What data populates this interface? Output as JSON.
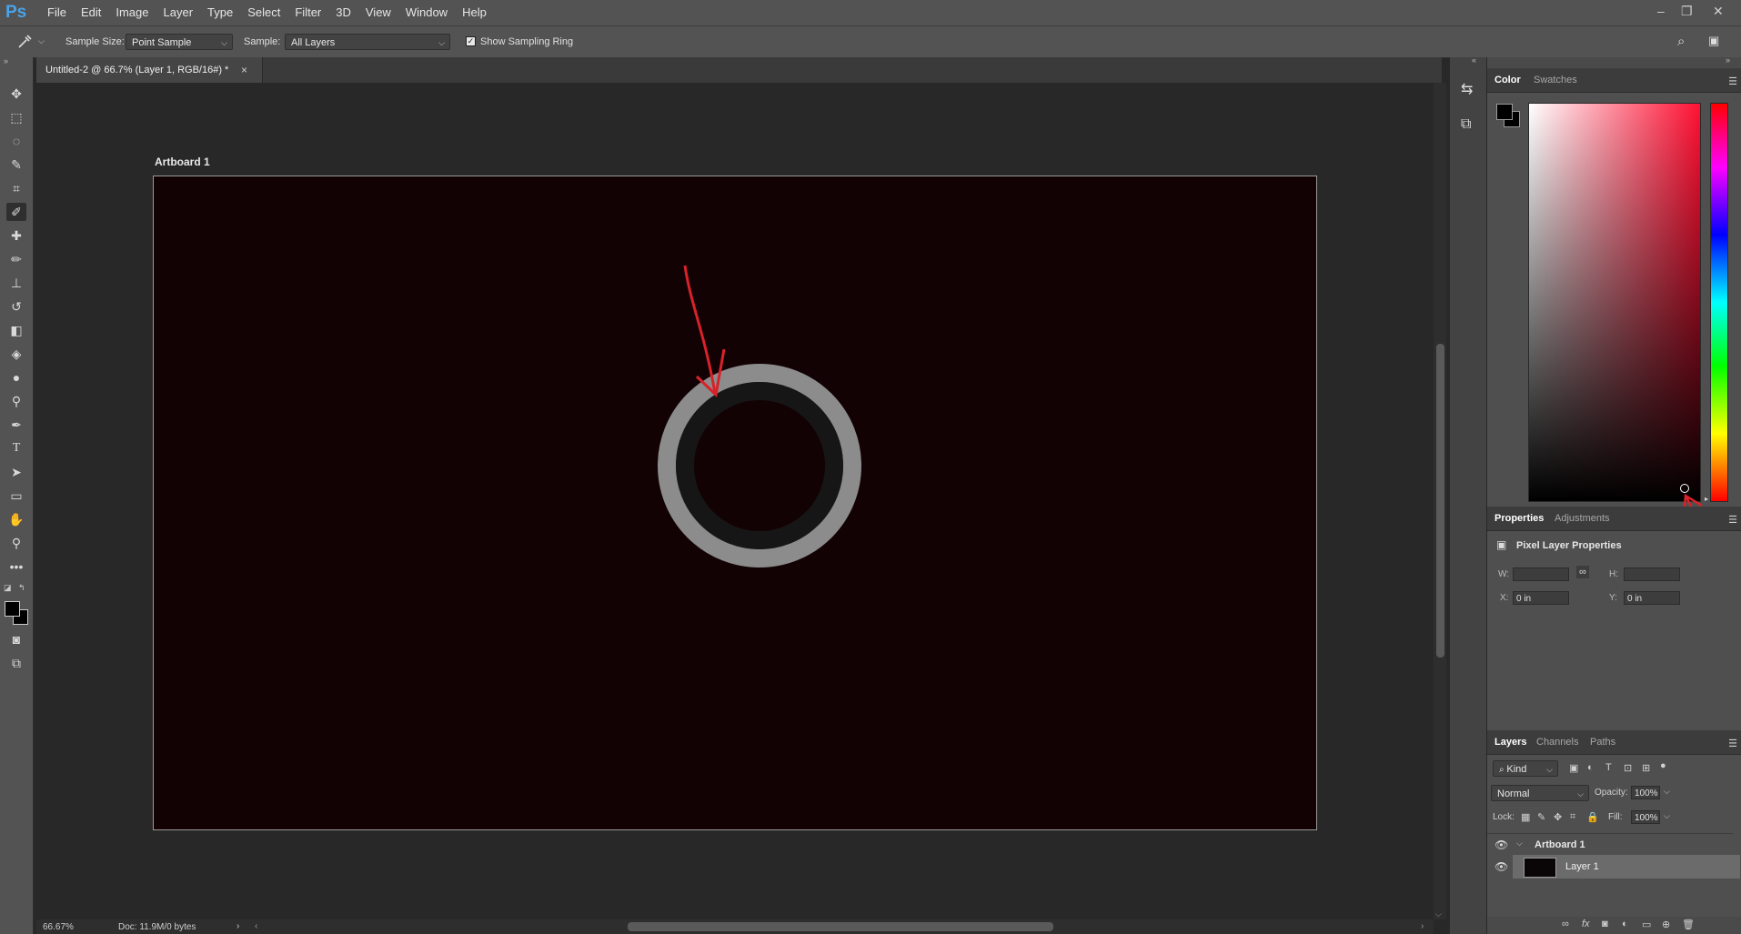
{
  "app": {
    "logo": "Ps"
  },
  "menu": [
    "File",
    "Edit",
    "Image",
    "Layer",
    "Type",
    "Select",
    "Filter",
    "3D",
    "View",
    "Window",
    "Help"
  ],
  "window_controls": {
    "minimize": "–",
    "restore": "❐",
    "close": "✕"
  },
  "options_bar": {
    "sample_size_label": "Sample Size:",
    "sample_size_value": "Point Sample",
    "sample_label": "Sample:",
    "sample_value": "All Layers",
    "show_ring_label": "Show Sampling Ring",
    "show_ring_checked": true
  },
  "document": {
    "tab_title": "Untitled-2 @ 66.7% (Layer 1, RGB/16#) *",
    "artboard_name": "Artboard 1",
    "canvas_color": "#120204",
    "zoom": "66.67%",
    "doc_info": "Doc: 11.9M/0 bytes"
  },
  "tools": [
    "move-icon",
    "marquee-icon",
    "lasso-icon",
    "quick-select-icon",
    "crop-icon",
    "eyedropper-icon",
    "healing-icon",
    "brush-icon",
    "stamp-icon",
    "history-brush-icon",
    "eraser-icon",
    "paint-bucket-icon",
    "blur-icon",
    "dodge-icon",
    "pen-icon",
    "type-icon",
    "path-select-icon",
    "rectangle-icon",
    "hand-icon",
    "zoom-icon",
    "more-icon"
  ],
  "color_panel": {
    "tabs": [
      "Color",
      "Swatches"
    ],
    "active_tab": "Color",
    "foreground": "#000000",
    "background": "#000000",
    "hue": "#ff1133"
  },
  "properties_panel": {
    "tabs": [
      "Properties",
      "Adjustments"
    ],
    "active_tab": "Properties",
    "title": "Pixel Layer Properties",
    "w_label": "W:",
    "h_label": "H:",
    "x_label": "X:",
    "y_label": "Y:",
    "x_value": "0 in",
    "y_value": "0 in"
  },
  "layers_panel": {
    "tabs": [
      "Layers",
      "Channels",
      "Paths"
    ],
    "active_tab": "Layers",
    "filter": "Kind",
    "blend_mode": "Normal",
    "opacity_label": "Opacity:",
    "opacity": "100%",
    "lock_label": "Lock:",
    "fill_label": "Fill:",
    "fill": "100%",
    "layers": [
      {
        "name": "Artboard 1",
        "type": "artboard"
      },
      {
        "name": "Layer 1",
        "type": "pixel",
        "selected": true
      }
    ]
  }
}
